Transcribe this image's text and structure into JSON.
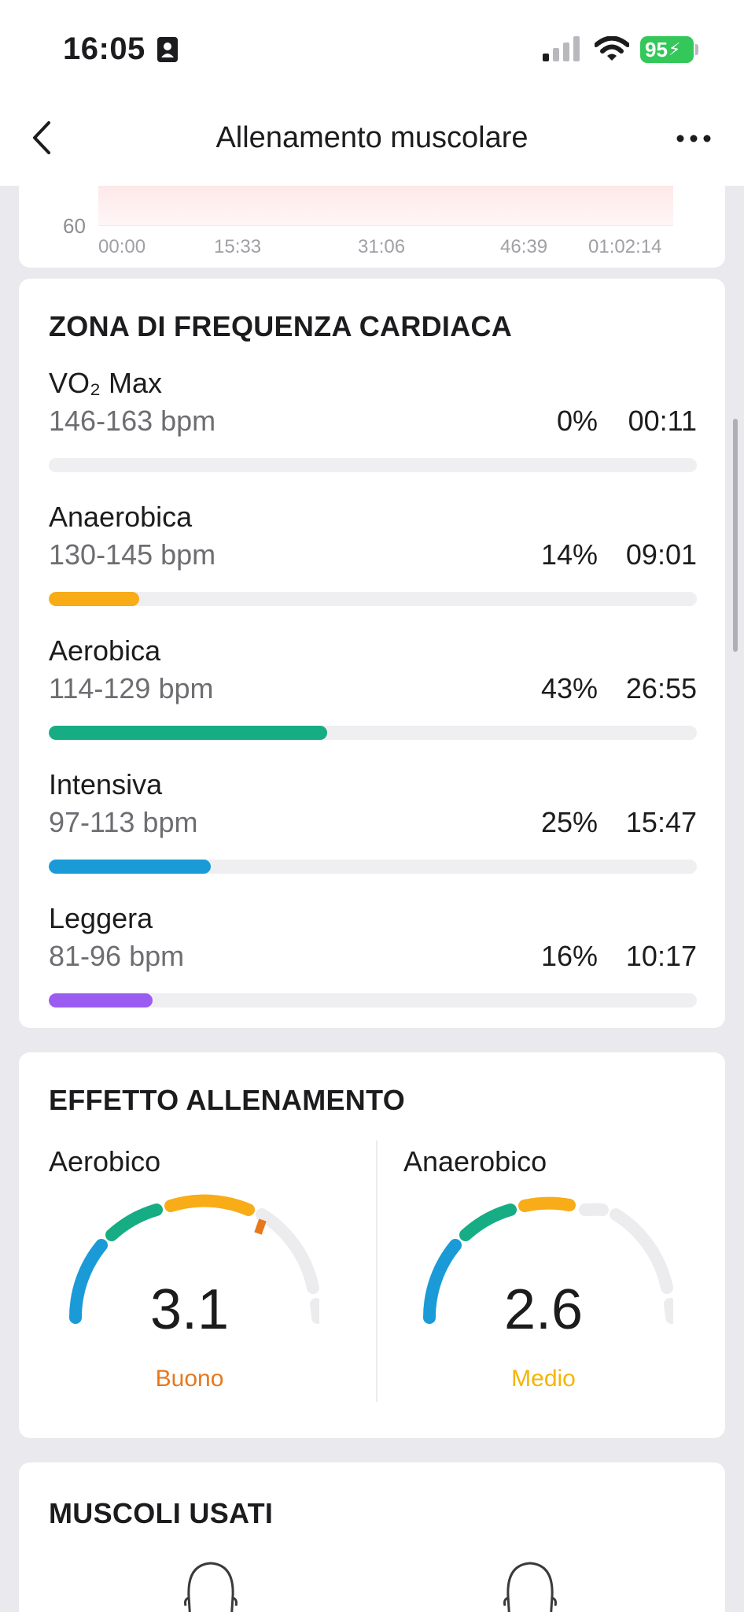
{
  "status_bar": {
    "time": "16:05",
    "battery": "95",
    "icons": [
      "contact-card-icon",
      "signal-icon",
      "wifi-icon",
      "battery-icon"
    ]
  },
  "nav": {
    "title": "Allenamento muscolare",
    "back_icon": "chevron-left-icon",
    "more_icon": "more-icon"
  },
  "hr_chart": {
    "y_label": "60",
    "x_labels": [
      "00:00",
      "15:33",
      "31:06",
      "46:39",
      "01:02:14"
    ]
  },
  "zones_card": {
    "title": "ZONA DI FREQUENZA CARDIACA",
    "zones": [
      {
        "name": "VO₂ Max",
        "range": "146-163 bpm",
        "percent": "0%",
        "time": "00:11",
        "fraction": 0.0,
        "color": "#f5a623"
      },
      {
        "name": "Anaerobica",
        "range": "130-145 bpm",
        "percent": "14%",
        "time": "09:01",
        "fraction": 0.14,
        "color": "#f8ac17"
      },
      {
        "name": "Aerobica",
        "range": "114-129 bpm",
        "percent": "43%",
        "time": "26:55",
        "fraction": 0.43,
        "color": "#16ad84"
      },
      {
        "name": "Intensiva",
        "range": "97-113 bpm",
        "percent": "25%",
        "time": "15:47",
        "fraction": 0.25,
        "color": "#1a9bd7"
      },
      {
        "name": "Leggera",
        "range": "81-96 bpm",
        "percent": "16%",
        "time": "10:17",
        "fraction": 0.16,
        "color": "#9b5cf2"
      }
    ]
  },
  "effect_card": {
    "title": "EFFETTO ALLENAMENTO",
    "aerobic": {
      "label": "Aerobico",
      "value": "3.1",
      "status": "Buono",
      "status_color": "#e8781c"
    },
    "anaerobic": {
      "label": "Anaerobico",
      "value": "2.6",
      "status": "Medio",
      "status_color": "#f5b400"
    }
  },
  "muscles_card": {
    "title": "MUSCOLI USATI"
  }
}
